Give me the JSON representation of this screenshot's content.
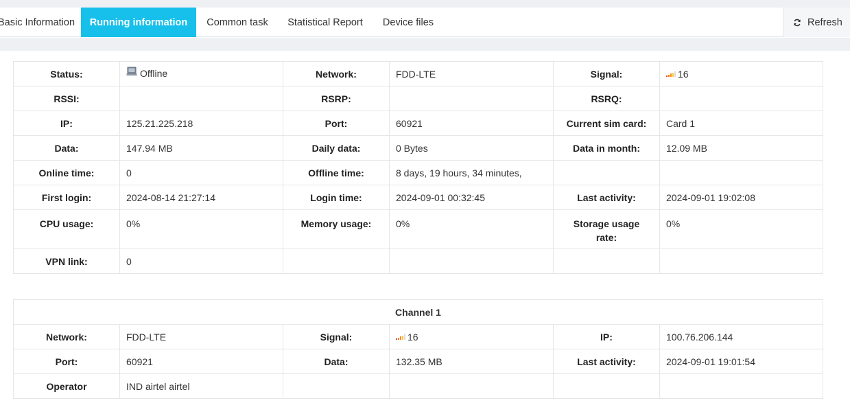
{
  "tabs": [
    {
      "label": "Basic Information",
      "active": false
    },
    {
      "label": "Running information",
      "active": true
    },
    {
      "label": "Common task",
      "active": false
    },
    {
      "label": "Statistical Report",
      "active": false
    },
    {
      "label": "Device files",
      "active": false
    }
  ],
  "refresh_label": "Refresh",
  "running": {
    "status_label": "Status:",
    "status_value": "Offline",
    "network_label": "Network:",
    "network_value": "FDD-LTE",
    "signal_label": "Signal:",
    "signal_value": "16",
    "rssi_label": "RSSI:",
    "rssi_value": "",
    "rsrp_label": "RSRP:",
    "rsrp_value": "",
    "rsrq_label": "RSRQ:",
    "rsrq_value": "",
    "ip_label": "IP:",
    "ip_value": "125.21.225.218",
    "port_label": "Port:",
    "port_value": "60921",
    "sim_label": "Current sim card:",
    "sim_value": "Card 1",
    "data_label": "Data:",
    "data_value": "147.94 MB",
    "daily_label": "Daily data:",
    "daily_value": "0 Bytes",
    "month_label": "Data in month:",
    "month_value": "12.09 MB",
    "online_label": "Online time:",
    "online_value": "0",
    "offline_label": "Offline time:",
    "offline_value": "8 days, 19 hours, 34 minutes,",
    "first_login_label": "First login:",
    "first_login_value": "2024-08-14 21:27:14",
    "login_time_label": "Login time:",
    "login_time_value": "2024-09-01 00:32:45",
    "last_activity_label": "Last activity:",
    "last_activity_value": "2024-09-01 19:02:08",
    "cpu_label": "CPU usage:",
    "cpu_value": "0%",
    "memory_label": "Memory usage:",
    "memory_value": "0%",
    "storage_label": "Storage usage rate:",
    "storage_value": "0%",
    "vpn_label": "VPN link:",
    "vpn_value": "0"
  },
  "channel": {
    "title": "Channel 1",
    "network_label": "Network:",
    "network_value": "FDD-LTE",
    "signal_label": "Signal:",
    "signal_value": "16",
    "ip_label": "IP:",
    "ip_value": "100.76.206.144",
    "port_label": "Port:",
    "port_value": "60921",
    "data_label": "Data:",
    "data_value": "132.35 MB",
    "last_activity_label": "Last activity:",
    "last_activity_value": "2024-09-01 19:01:54",
    "operator_label": "Operator",
    "operator_value": "IND airtel airtel"
  },
  "colors": {
    "accent": "#16c0ea",
    "signal_bars": [
      "#e53935",
      "#f57c00",
      "#fb8c00",
      "#c8c8c8",
      "#c8c8c8"
    ]
  },
  "icons": {
    "status": "computer-icon",
    "signal": "signal-bars-icon",
    "refresh": "refresh-icon"
  }
}
